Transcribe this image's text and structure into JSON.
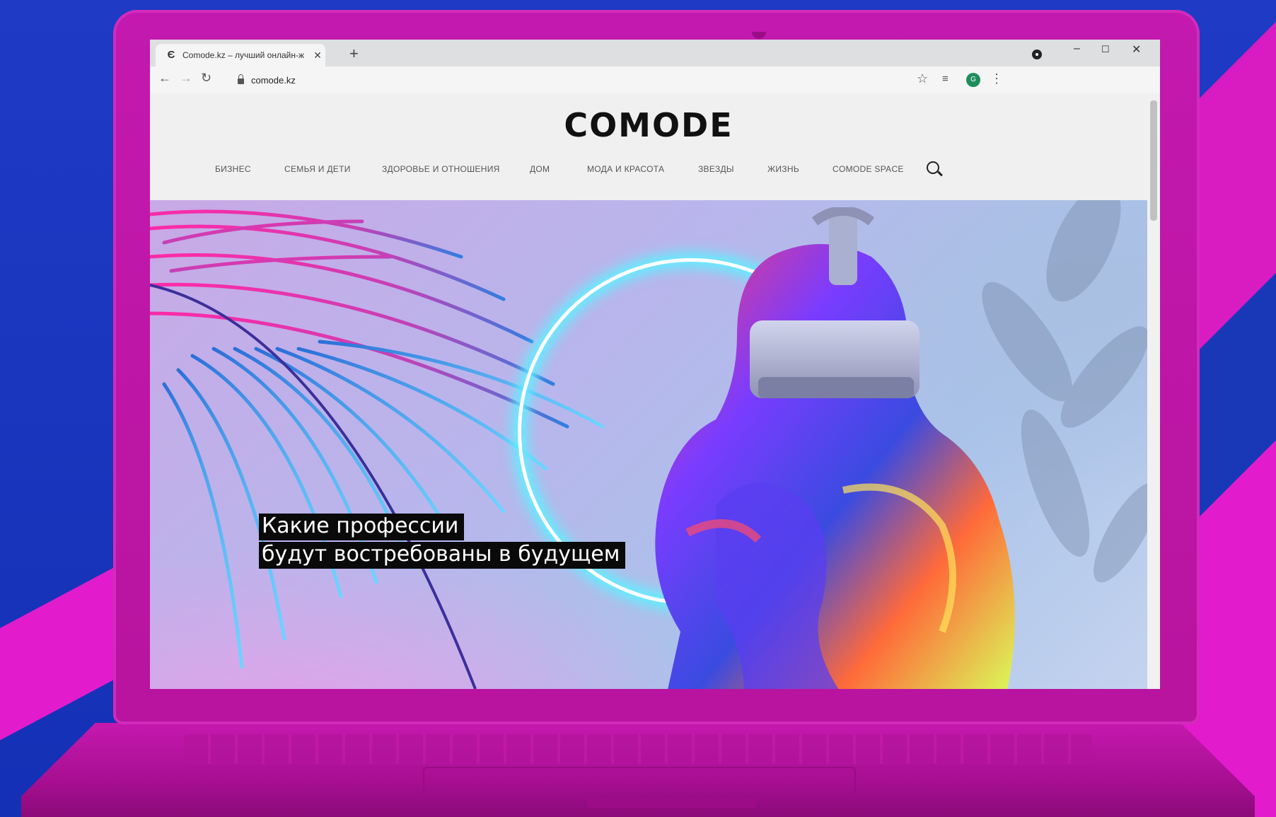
{
  "browser": {
    "tab_title": "Comode.kz – лучший онлайн-ж",
    "tab_favicon": "Є",
    "tab_close": "✕",
    "new_tab": "+",
    "url": "comode.kz",
    "avatar_initial": "G",
    "window_controls": {
      "minimize": "–",
      "maximize": "☐",
      "close": "✕"
    },
    "nav": {
      "back": "←",
      "forward": "→",
      "reload": "↻"
    },
    "star": "☆",
    "menu": "⋮",
    "cast": "≡"
  },
  "site": {
    "logo": "COMODE",
    "nav": [
      "БИЗНЕС",
      "СЕМЬЯ И ДЕТИ",
      "ЗДОРОВЬЕ И ОТНОШЕНИЯ",
      "ДОМ",
      "МОДА И КРАСОТА",
      "ЗВЕЗДЫ",
      "ЖИЗНЬ",
      "COMODE SPACE"
    ]
  },
  "hero": {
    "headline_line1": "Какие профессии",
    "headline_line2": "будут востребованы в будущем"
  },
  "colors": {
    "laptop": "#c319ae",
    "background_blue": "#1f3bc6",
    "accent_pink": "#e21ccd",
    "neon_ring": "#5ff0ff"
  }
}
